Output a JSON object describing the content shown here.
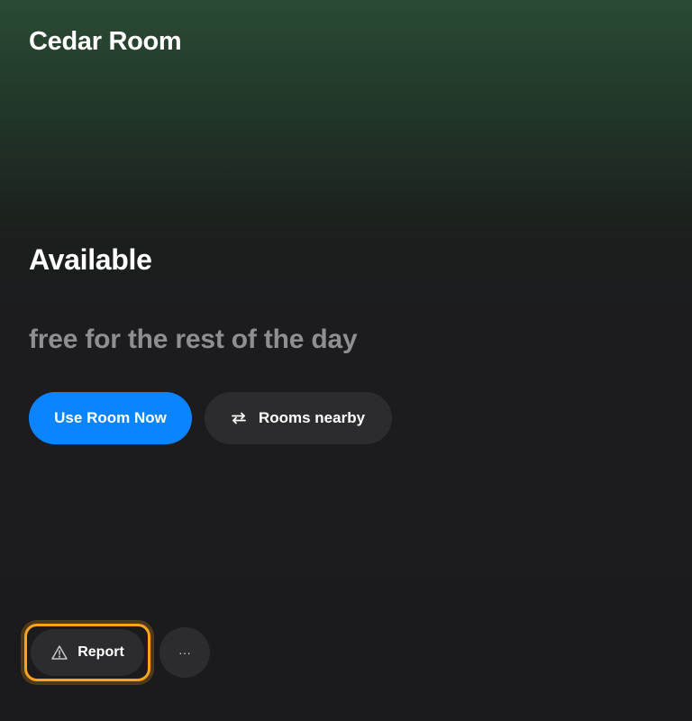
{
  "header": {
    "room_name": "Cedar Room"
  },
  "status": {
    "state": "Available",
    "detail": "free for the rest of the day"
  },
  "actions": {
    "primary_label": "Use Room Now",
    "secondary_label": "Rooms nearby",
    "secondary_icon": "swap-arrows-icon"
  },
  "footer": {
    "report_label": "Report",
    "report_icon": "warning-triangle-icon",
    "more_label": "···",
    "focused_item": "report"
  },
  "colors": {
    "primary_button": "#0a84ff",
    "secondary_button": "#2c2c2e",
    "focus_ring": "#ffa31a",
    "header_gradient_top": "#2a4b34",
    "background": "#1b1b1d",
    "muted_text": "#8e8e93"
  }
}
